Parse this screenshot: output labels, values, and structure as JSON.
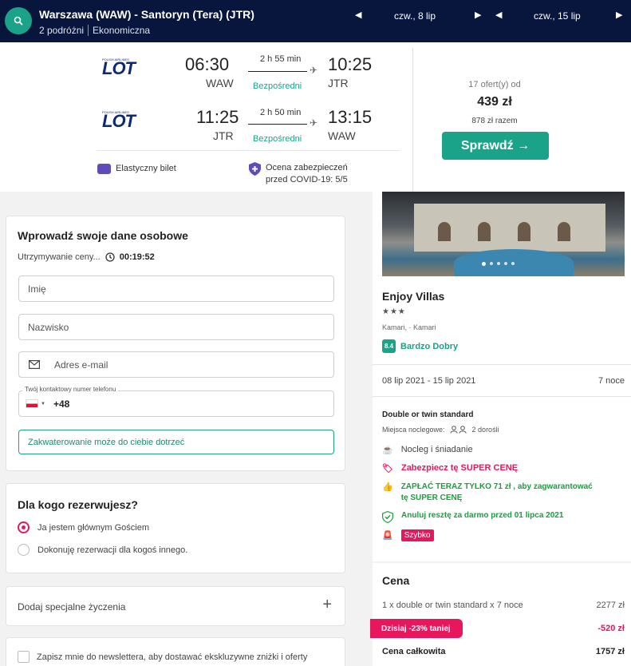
{
  "search": {
    "route": "Warszawa (WAW) - Santoryn (Tera) (JTR)",
    "travellers": "2 podróżni",
    "cabin": "Ekonomiczna",
    "depart_date": "czw., 8 lip",
    "return_date": "czw., 15 lip"
  },
  "flights": [
    {
      "airline": "LOT",
      "airline_small": "POLISH AIRLINES",
      "dep_time": "06:30",
      "dep_code": "WAW",
      "duration": "2 h 55 min",
      "stops": "Bezpośredni",
      "arr_time": "10:25",
      "arr_code": "JTR"
    },
    {
      "airline": "LOT",
      "airline_small": "POLISH AIRLINES",
      "dep_time": "11:25",
      "dep_code": "JTR",
      "duration": "2 h 50 min",
      "stops": "Bezpośredni",
      "arr_time": "13:15",
      "arr_code": "WAW"
    }
  ],
  "features": {
    "flexible": "Elastyczny bilet",
    "covid_line1": "Ocena zabezpieczeń",
    "covid_line2": "przed COVID-19: 5/5"
  },
  "offer": {
    "count": "17 ofert(y) od",
    "price": "439 zł",
    "total": "878 zł razem",
    "button": "Sprawdź →"
  },
  "personal": {
    "title": "Wprowadź swoje dane osobowe",
    "hold_label": "Utrzymywanie ceny...",
    "hold_timer": "00:19:52",
    "first_name_placeholder": "Imię",
    "last_name_placeholder": "Nazwisko",
    "email_placeholder": "Adres e-mail",
    "phone_label": "Twój kontaktowy numer telefonu",
    "phone_prefix": "+48",
    "notice": "Zakwaterowanie może do ciebie dotrzeć"
  },
  "booking_for": {
    "title": "Dla kogo rezerwujesz?",
    "option1": "Ja jestem głównym Gościem",
    "option2": "Dokonuję rezerwacji dla kogoś innego."
  },
  "special_requests": "Dodaj specjalne życzenia",
  "newsletter": "Zapisz mnie do newslettera, aby dostawać ekskluzywne zniżki i oferty",
  "hotel": {
    "name": "Enjoy Villas",
    "stars": "★★★",
    "location": "Kamari, · Kamari",
    "score": "8.4",
    "score_text": "Bardzo Dobry",
    "dates": "08 lip 2021 - 15 lip 2021",
    "nights": "7 noce",
    "room": "Double or twin standard",
    "beds_label": "Miejsca noclegowe:",
    "beds_value": "2 dorośli",
    "board": "Nocleg i śniadanie",
    "super_price": "Zabezpiecz tę SUPER CENĘ",
    "pay_now_line1": "ZAPŁAĆ TERAZ TYLKO 71 zł , aby zagwarantować",
    "pay_now_line2": "tę SUPER CENĘ",
    "cancel": "Anuluj resztę za darmo przed 01 lipca 2021",
    "fast": "Szybko"
  },
  "pricing": {
    "title": "Cena",
    "line_label": "1 x double or twin standard x 7 noce",
    "line_value": "2277 zł",
    "discount_label": "Dzisiaj -23% taniej",
    "discount_value": "-520 zł",
    "total_label": "Cena całkowita",
    "total_value": "1757 zł"
  },
  "colors": {
    "navy": "#08153d",
    "teal": "#1aa388",
    "pink": "#e8175d",
    "green": "#1a9e3e"
  }
}
